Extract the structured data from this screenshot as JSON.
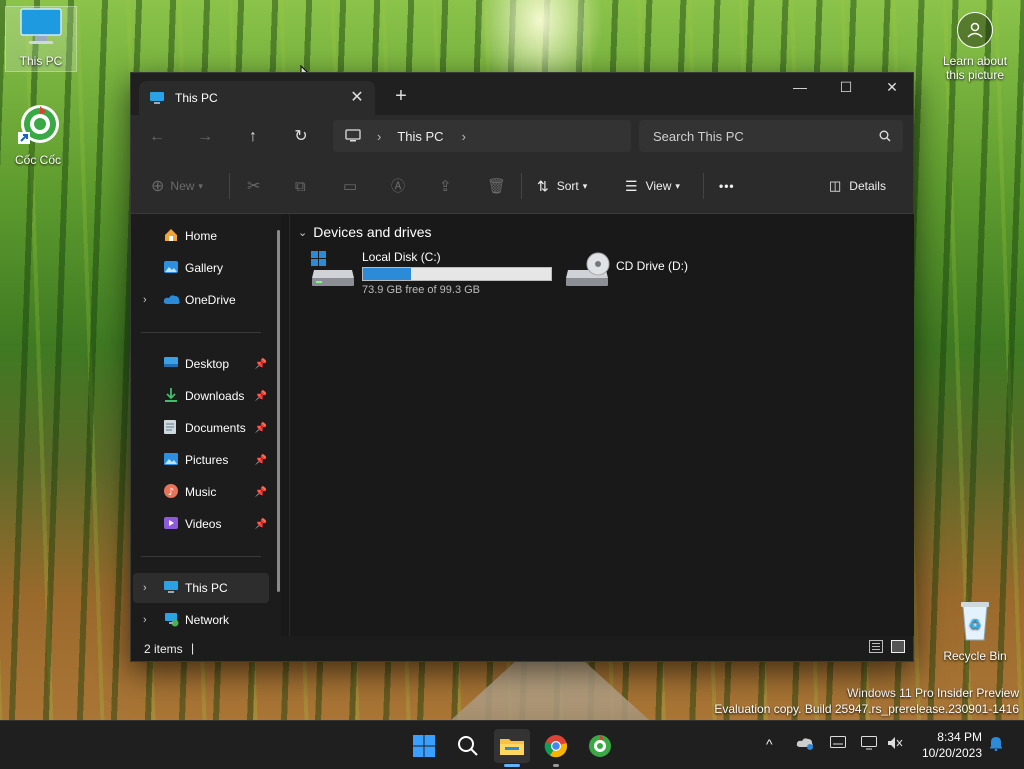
{
  "desktop": {
    "icons": [
      {
        "label": "This PC"
      },
      {
        "label": "Cốc Cốc"
      },
      {
        "label": "Recycle Bin"
      }
    ],
    "learn_label_line1": "Learn about",
    "learn_label_line2": "this picture",
    "watermark_line1": "Windows 11 Pro Insider Preview",
    "watermark_line2": "Evaluation copy. Build 25947.rs_prerelease.230901-1416"
  },
  "window": {
    "tab_title": "This PC",
    "tab_close": "✕",
    "new_tab": "+",
    "minimize": "—",
    "maximize": "☐",
    "close": "✕"
  },
  "navbar": {
    "back": "←",
    "forward": "→",
    "up": "↑",
    "refresh": "↻",
    "breadcrumb": "This PC",
    "search_placeholder": "Search This PC"
  },
  "toolbar": {
    "new_label": "New",
    "sort_label": "Sort",
    "view_label": "View",
    "more_label": "•••",
    "details_label": "Details"
  },
  "sidebar": {
    "items": [
      {
        "label": "Home"
      },
      {
        "label": "Gallery"
      },
      {
        "label": "OneDrive"
      },
      {
        "label": "Desktop"
      },
      {
        "label": "Downloads"
      },
      {
        "label": "Documents"
      },
      {
        "label": "Pictures"
      },
      {
        "label": "Music"
      },
      {
        "label": "Videos"
      },
      {
        "label": "This PC"
      },
      {
        "label": "Network"
      }
    ]
  },
  "content": {
    "group_title": "Devices and drives",
    "drives": [
      {
        "name": "Local Disk (C:)",
        "free_text": "73.9 GB free of 99.3 GB",
        "used_fraction": 0.256
      },
      {
        "name": "CD Drive (D:)"
      }
    ]
  },
  "status": {
    "items_count": "2 items",
    "cursor": "|"
  },
  "taskbar": {
    "time": "8:34 PM",
    "date": "10/20/2023",
    "tray_chevron": "^"
  },
  "colors": {
    "accent": "#2b8bd8",
    "window_bg": "#191919",
    "toolbar_bg": "#2b2b2b",
    "taskbar_bg": "#1f1f1f"
  }
}
